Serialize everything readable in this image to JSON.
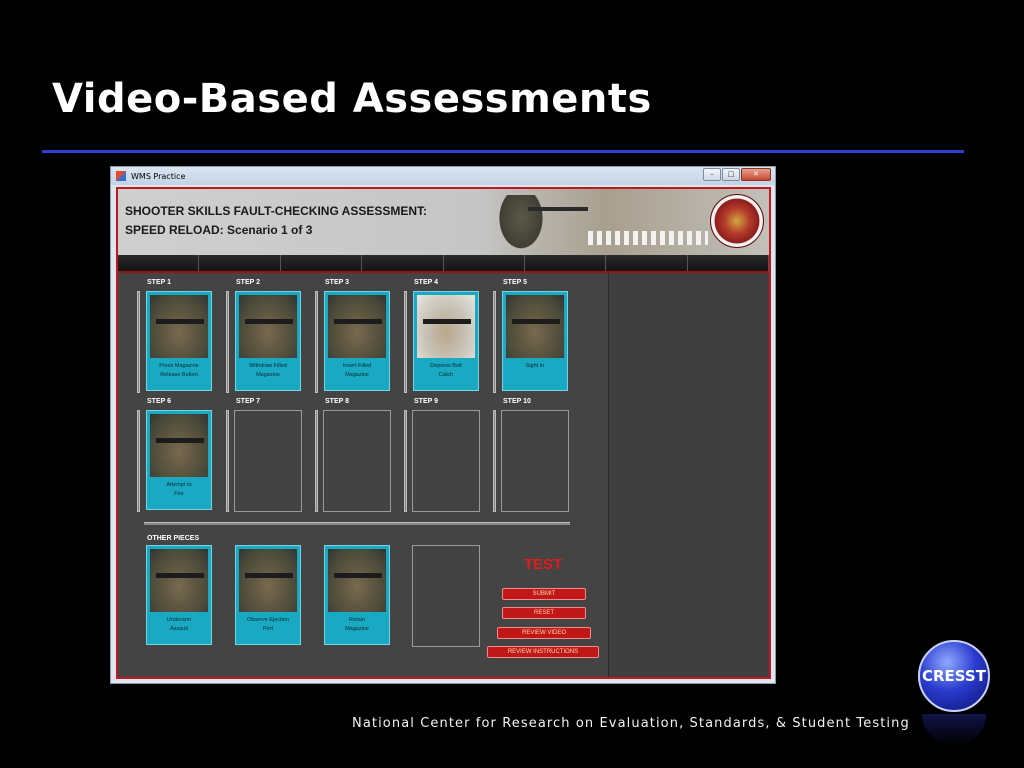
{
  "slide": {
    "title": "Video-Based Assessments",
    "footer": "National Center for Research on Evaluation, Standards, & Student Testing",
    "logo_text": "CRESST"
  },
  "window": {
    "title": "WMS Practice",
    "controls": {
      "minimize": "–",
      "maximize": "□",
      "close": "✕"
    }
  },
  "banner": {
    "line1": "SHOOTER SKILLS FAULT-CHECKING ASSESSMENT:",
    "line2": "SPEED RELOAD: Scenario 1 of 3"
  },
  "steps": [
    {
      "label": "STEP 1",
      "caption": [
        "Press Magazine",
        "Release Button"
      ],
      "filled": true
    },
    {
      "label": "STEP 2",
      "caption": [
        "Withdraw Filled",
        "Magazine"
      ],
      "filled": true
    },
    {
      "label": "STEP 3",
      "caption": [
        "Insert Filled",
        "Magazine"
      ],
      "filled": true
    },
    {
      "label": "STEP 4",
      "caption": [
        "Depress Bolt",
        "Catch"
      ],
      "filled": true
    },
    {
      "label": "STEP 5",
      "caption": [
        "Sight In",
        ""
      ],
      "filled": true
    },
    {
      "label": "STEP 6",
      "caption": [
        "Attempt to",
        "Fire"
      ],
      "filled": true
    },
    {
      "label": "STEP 7",
      "caption": [
        "",
        ""
      ],
      "filled": false
    },
    {
      "label": "STEP 8",
      "caption": [
        "",
        ""
      ],
      "filled": false
    },
    {
      "label": "STEP 9",
      "caption": [
        "",
        ""
      ],
      "filled": false
    },
    {
      "label": "STEP 10",
      "caption": [
        "",
        ""
      ],
      "filled": false
    }
  ],
  "other_pieces": {
    "label": "OTHER PIECES",
    "items": [
      {
        "caption": [
          "Underarm",
          "Assault"
        ]
      },
      {
        "caption": [
          "Observe Ejection",
          "Port"
        ]
      },
      {
        "caption": [
          "Retain",
          "Magazine"
        ]
      }
    ]
  },
  "actions": {
    "test_label": "TEST",
    "submit": "SUBMIT",
    "reset": "RESET",
    "review_video": "REVIEW VIDEO",
    "review_instructions": "REVIEW INSTRUCTIONS"
  },
  "colors": {
    "card": "#19a9c2",
    "frame_border": "#c0181f",
    "button": "#c01818",
    "title_rule": "#2f3fd6"
  }
}
